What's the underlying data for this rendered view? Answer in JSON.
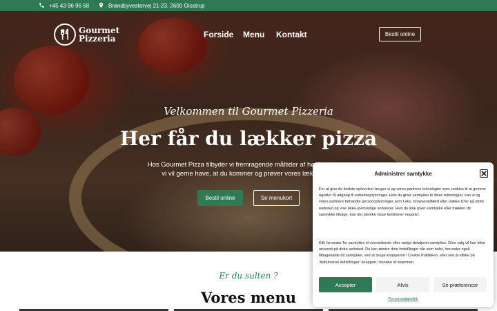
{
  "topbar": {
    "phone": "+45 43 96 96 68",
    "address": "Brøndbyvestervej 21-23, 2600 Glostrup",
    "phone_icon": "phone-icon",
    "address_icon": "map-pin-icon"
  },
  "logo": {
    "line1": "Gourmet",
    "line2": "Pizzeria",
    "icon": "fork-knife-icon"
  },
  "nav": {
    "home": "Forside",
    "menu": "Menu",
    "contact": "Kontakt",
    "order_button": "Bestil online"
  },
  "hero": {
    "welcome": "Velkommen til Gourmet Pizzeria",
    "headline": "Her får du lækker pizza",
    "subtext": "Hos Gourmet Pizza tilbyder vi fremragende måltider af høj kvalitet, og vi vil gerne have, at du kommer og prøver vores lækre mad.",
    "order_button": "Bestil online",
    "menu_button": "Se menukort"
  },
  "menu_section": {
    "tagline": "Er du sulten ?",
    "title": "Vores menu"
  },
  "cookie": {
    "title": "Administrer samtykke",
    "close_icon": "close-icon",
    "paragraph1": "For at give de bedste oplevelser bruger vi og vores partnere teknologier som cookies til at gemme og/eller få adgang til enhedsoplysninger. Hvis du giver samtykke til disse teknologier, kan vi og vores partnere behandle personoplysninger som f.eks. browseradfærd eller unikke ID'er på dette websted og vise (ikke-)personlige annoncer. Hvis du ikke giver samtykke eller trækker dit samtykke tilbage, kan det påvirke visse funktioner negativt.",
    "paragraph2": "Klik herunder for samtykke til ovenstående eller vælge detaljeret samtykke. Dine valg vil kun blive anvendt på dette websted. Du kan ændre dine indstillinger når som helst, herunder også tilbagekalde dit samtykke, ved at bruge knapperne i Cookie Politikken, eller ved at klikke på 'Administrer indstillinger' knappen i bunden af skærmen.",
    "accept": "Accepter",
    "reject": "Afvis",
    "preferences": "Se præferencer",
    "policy_link": "Persondatapolitik"
  },
  "colors": {
    "brand_green": "#2f7a55"
  }
}
